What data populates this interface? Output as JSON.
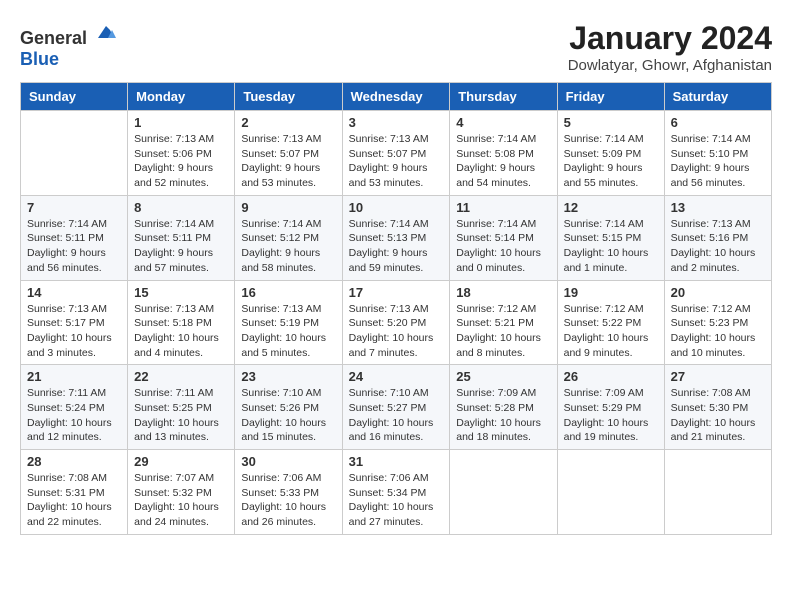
{
  "header": {
    "logo_general": "General",
    "logo_blue": "Blue",
    "month_title": "January 2024",
    "location": "Dowlatyar, Ghowr, Afghanistan"
  },
  "calendar": {
    "days_of_week": [
      "Sunday",
      "Monday",
      "Tuesday",
      "Wednesday",
      "Thursday",
      "Friday",
      "Saturday"
    ],
    "weeks": [
      [
        {
          "day": "",
          "info": ""
        },
        {
          "day": "1",
          "info": "Sunrise: 7:13 AM\nSunset: 5:06 PM\nDaylight: 9 hours\nand 52 minutes."
        },
        {
          "day": "2",
          "info": "Sunrise: 7:13 AM\nSunset: 5:07 PM\nDaylight: 9 hours\nand 53 minutes."
        },
        {
          "day": "3",
          "info": "Sunrise: 7:13 AM\nSunset: 5:07 PM\nDaylight: 9 hours\nand 53 minutes."
        },
        {
          "day": "4",
          "info": "Sunrise: 7:14 AM\nSunset: 5:08 PM\nDaylight: 9 hours\nand 54 minutes."
        },
        {
          "day": "5",
          "info": "Sunrise: 7:14 AM\nSunset: 5:09 PM\nDaylight: 9 hours\nand 55 minutes."
        },
        {
          "day": "6",
          "info": "Sunrise: 7:14 AM\nSunset: 5:10 PM\nDaylight: 9 hours\nand 56 minutes."
        }
      ],
      [
        {
          "day": "7",
          "info": "Sunrise: 7:14 AM\nSunset: 5:11 PM\nDaylight: 9 hours\nand 56 minutes."
        },
        {
          "day": "8",
          "info": "Sunrise: 7:14 AM\nSunset: 5:11 PM\nDaylight: 9 hours\nand 57 minutes."
        },
        {
          "day": "9",
          "info": "Sunrise: 7:14 AM\nSunset: 5:12 PM\nDaylight: 9 hours\nand 58 minutes."
        },
        {
          "day": "10",
          "info": "Sunrise: 7:14 AM\nSunset: 5:13 PM\nDaylight: 9 hours\nand 59 minutes."
        },
        {
          "day": "11",
          "info": "Sunrise: 7:14 AM\nSunset: 5:14 PM\nDaylight: 10 hours\nand 0 minutes."
        },
        {
          "day": "12",
          "info": "Sunrise: 7:14 AM\nSunset: 5:15 PM\nDaylight: 10 hours\nand 1 minute."
        },
        {
          "day": "13",
          "info": "Sunrise: 7:13 AM\nSunset: 5:16 PM\nDaylight: 10 hours\nand 2 minutes."
        }
      ],
      [
        {
          "day": "14",
          "info": "Sunrise: 7:13 AM\nSunset: 5:17 PM\nDaylight: 10 hours\nand 3 minutes."
        },
        {
          "day": "15",
          "info": "Sunrise: 7:13 AM\nSunset: 5:18 PM\nDaylight: 10 hours\nand 4 minutes."
        },
        {
          "day": "16",
          "info": "Sunrise: 7:13 AM\nSunset: 5:19 PM\nDaylight: 10 hours\nand 5 minutes."
        },
        {
          "day": "17",
          "info": "Sunrise: 7:13 AM\nSunset: 5:20 PM\nDaylight: 10 hours\nand 7 minutes."
        },
        {
          "day": "18",
          "info": "Sunrise: 7:12 AM\nSunset: 5:21 PM\nDaylight: 10 hours\nand 8 minutes."
        },
        {
          "day": "19",
          "info": "Sunrise: 7:12 AM\nSunset: 5:22 PM\nDaylight: 10 hours\nand 9 minutes."
        },
        {
          "day": "20",
          "info": "Sunrise: 7:12 AM\nSunset: 5:23 PM\nDaylight: 10 hours\nand 10 minutes."
        }
      ],
      [
        {
          "day": "21",
          "info": "Sunrise: 7:11 AM\nSunset: 5:24 PM\nDaylight: 10 hours\nand 12 minutes."
        },
        {
          "day": "22",
          "info": "Sunrise: 7:11 AM\nSunset: 5:25 PM\nDaylight: 10 hours\nand 13 minutes."
        },
        {
          "day": "23",
          "info": "Sunrise: 7:10 AM\nSunset: 5:26 PM\nDaylight: 10 hours\nand 15 minutes."
        },
        {
          "day": "24",
          "info": "Sunrise: 7:10 AM\nSunset: 5:27 PM\nDaylight: 10 hours\nand 16 minutes."
        },
        {
          "day": "25",
          "info": "Sunrise: 7:09 AM\nSunset: 5:28 PM\nDaylight: 10 hours\nand 18 minutes."
        },
        {
          "day": "26",
          "info": "Sunrise: 7:09 AM\nSunset: 5:29 PM\nDaylight: 10 hours\nand 19 minutes."
        },
        {
          "day": "27",
          "info": "Sunrise: 7:08 AM\nSunset: 5:30 PM\nDaylight: 10 hours\nand 21 minutes."
        }
      ],
      [
        {
          "day": "28",
          "info": "Sunrise: 7:08 AM\nSunset: 5:31 PM\nDaylight: 10 hours\nand 22 minutes."
        },
        {
          "day": "29",
          "info": "Sunrise: 7:07 AM\nSunset: 5:32 PM\nDaylight: 10 hours\nand 24 minutes."
        },
        {
          "day": "30",
          "info": "Sunrise: 7:06 AM\nSunset: 5:33 PM\nDaylight: 10 hours\nand 26 minutes."
        },
        {
          "day": "31",
          "info": "Sunrise: 7:06 AM\nSunset: 5:34 PM\nDaylight: 10 hours\nand 27 minutes."
        },
        {
          "day": "",
          "info": ""
        },
        {
          "day": "",
          "info": ""
        },
        {
          "day": "",
          "info": ""
        }
      ]
    ]
  }
}
